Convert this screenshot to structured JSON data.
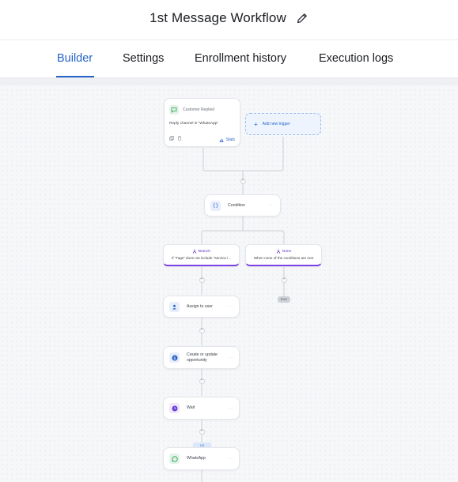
{
  "workflow": {
    "title": "1st Message Workflow"
  },
  "tabs": [
    {
      "label": "Builder",
      "active": true
    },
    {
      "label": "Settings",
      "active": false
    },
    {
      "label": "Enrollment history",
      "active": false
    },
    {
      "label": "Execution logs",
      "active": false
    }
  ],
  "colors": {
    "accent": "#2563c9",
    "branch": "#7b3fe4",
    "whatsapp": "#25a244"
  },
  "trigger": {
    "title": "Customer Replied",
    "detail": "Reply channel is \"WhatsApp\"",
    "stats_label": "Stats"
  },
  "add_trigger": {
    "label": "Add new trigger"
  },
  "condition": {
    "label": "Condition"
  },
  "branches": [
    {
      "title": "Branch",
      "description": "If \"Tags\" does not include \"service i..."
    },
    {
      "title": "None",
      "description": "When none of the conditions are met"
    }
  ],
  "end_label": "END",
  "steps": [
    {
      "label": "Assign to user",
      "icon": "user-icon"
    },
    {
      "label": "Create or update opportunity",
      "icon": "dollar-icon"
    },
    {
      "label": "Wait",
      "icon": "clock-icon"
    },
    {
      "label": "WhatsApp",
      "icon": "whatsapp-icon"
    }
  ],
  "mini_badge": "1/0"
}
